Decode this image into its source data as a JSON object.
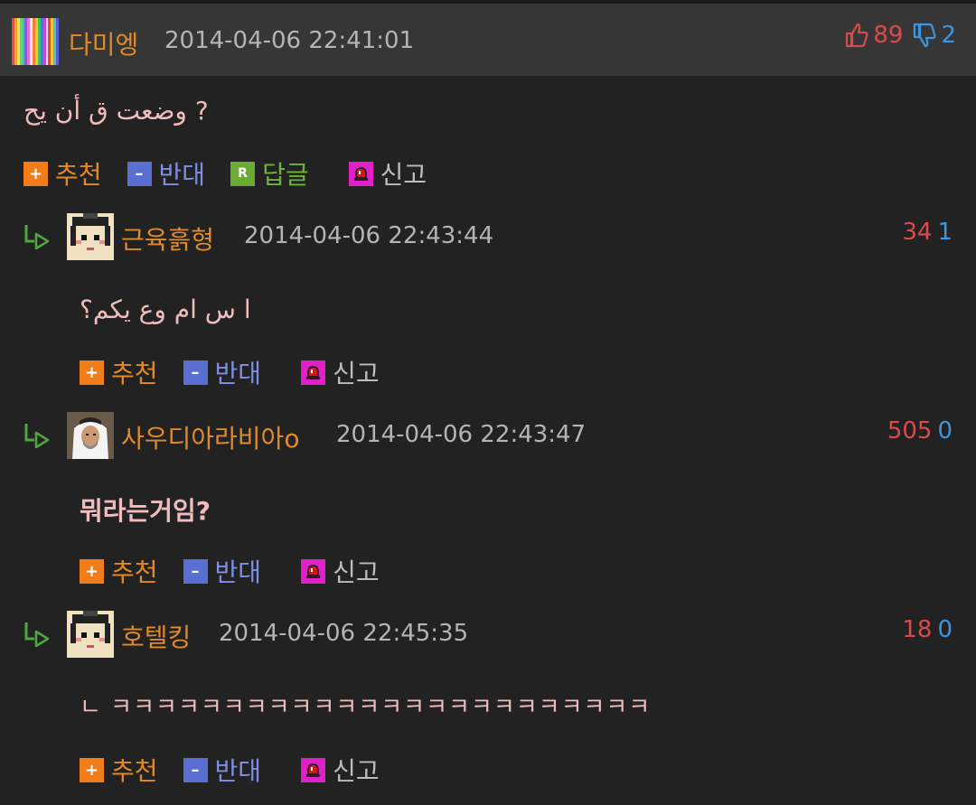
{
  "post": {
    "author": "다미엥",
    "date": "2014-04-06 22:41:01",
    "upvotes": "89",
    "downvotes": "2",
    "text": "وضعت ق أن يح ?"
  },
  "actions": {
    "recommend": "추천",
    "oppose": "반대",
    "reply": "답글",
    "report": "신고",
    "reply_icon_letter": "R"
  },
  "comments": [
    {
      "author": "근육흙형",
      "date": "2014-04-06 22:43:44",
      "up": "34",
      "down": "1",
      "text": "ا س ام وع يكم؟"
    },
    {
      "author": "사우디아라비아o",
      "date": "2014-04-06 22:43:47",
      "up": "505",
      "down": "0",
      "text": "뭐라는거임?"
    },
    {
      "author": "호텔킹",
      "date": "2014-04-06 22:45:35",
      "up": "18",
      "down": "0",
      "text": "ㄴ ㅋㅋㅋㅋㅋㅋㅋㅋㅋㅋㅋㅋㅋㅋㅋㅋㅋㅋㅋㅋㅋㅋㅋㅋ"
    }
  ],
  "colors": {
    "background": "#222222",
    "header": "#363636",
    "author": "#e08a2a",
    "date": "#b4b4b4",
    "upvote": "#d94a4a",
    "downvote": "#3d95e0",
    "comment_text": "#f0bcbc"
  },
  "icons": [
    "thumbs-up-icon",
    "thumbs-down-icon",
    "plus-icon",
    "minus-icon",
    "reply-icon",
    "siren-icon",
    "reply-arrow-icon"
  ]
}
